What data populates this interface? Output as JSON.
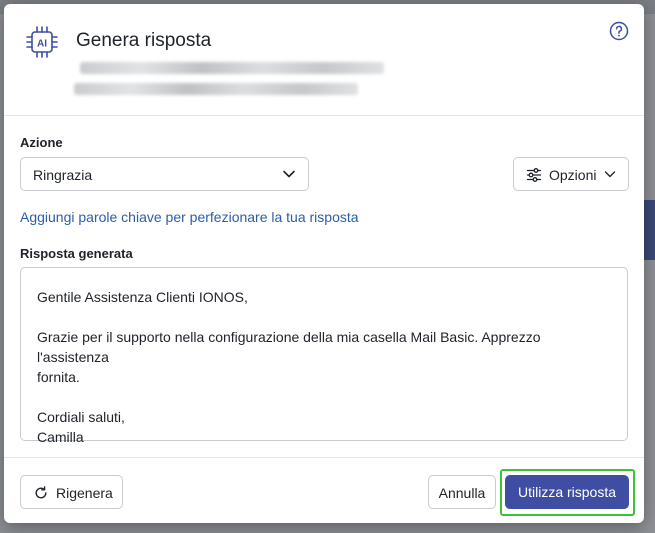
{
  "dialog": {
    "title": "Genera risposta",
    "ai_icon_text": "AI"
  },
  "azione": {
    "label": "Azione",
    "selected": "Ringrazia"
  },
  "opzioni": {
    "label": "Opzioni"
  },
  "keywords_link": "Aggiungi parole chiave per perfezionare la tua risposta",
  "risposta": {
    "label": "Risposta generata",
    "greeting": "Gentile Assistenza Clienti IONOS,",
    "body": "Grazie per il supporto nella configurazione della mia casella Mail Basic. Apprezzo l'assistenza\nfornita.",
    "closing": "Cordiali saluti,",
    "signature": "Camilla"
  },
  "footer": {
    "rigenera": "Rigenera",
    "annulla": "Annulla",
    "utilizza": "Utilizza risposta"
  },
  "colors": {
    "primary": "#3f4ea3",
    "link": "#2b5ea8",
    "highlight": "#3fc13a"
  }
}
